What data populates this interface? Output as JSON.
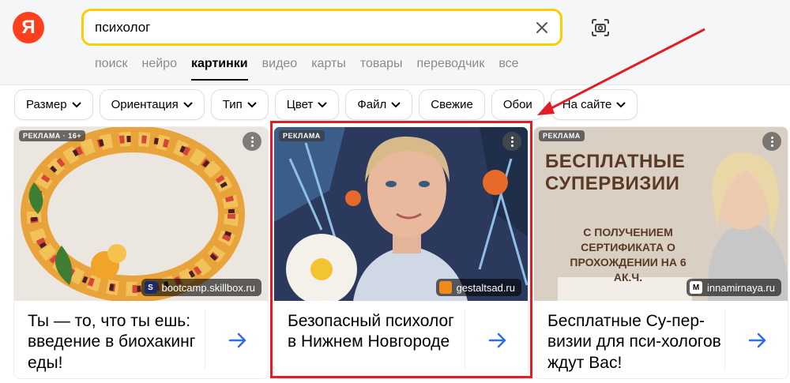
{
  "search": {
    "query": "психолог"
  },
  "logo": {
    "letter": "Я"
  },
  "nav": [
    "поиск",
    "нейро",
    "картинки",
    "видео",
    "карты",
    "товары",
    "переводчик",
    "все"
  ],
  "filters": [
    {
      "label": "Размер",
      "dropdown": true
    },
    {
      "label": "Ориентация",
      "dropdown": true
    },
    {
      "label": "Тип",
      "dropdown": true
    },
    {
      "label": "Цвет",
      "dropdown": true
    },
    {
      "label": "Файл",
      "dropdown": true
    },
    {
      "label": "Свежие",
      "dropdown": false
    },
    {
      "label": "Обои",
      "dropdown": false
    },
    {
      "label": "На сайте",
      "dropdown": true
    }
  ],
  "cards": [
    {
      "badge": "РЕКЛАМА · 16+",
      "domain": "bootcamp.skillbox.ru",
      "title": "Ты — то, что ты ешь: введение в биохакинг еды!"
    },
    {
      "badge": "РЕКЛАМА",
      "domain": "gestaltsad.ru",
      "title": "Безопасный психолог в Нижнем Новгороде"
    },
    {
      "badge": "РЕКЛАМА",
      "domain": "innamirnaya.ru",
      "title": "Бесплатные Су-пер­визии для пси-хологов ждут Вас!",
      "banner_title": "БЕСПЛАТНЫЕ СУПЕРВИЗИИ",
      "banner_sub": "С ПОЛУЧЕНИЕМ СЕРТИФИКАТА О ПРОХОЖДЕНИИ НА 6 АК.Ч."
    }
  ],
  "colors": {
    "accent_yellow": "#ffcc00",
    "logo_red": "#fc3f1d",
    "highlight_red": "#e31d24",
    "arrow_blue": "#2f6fe4"
  }
}
